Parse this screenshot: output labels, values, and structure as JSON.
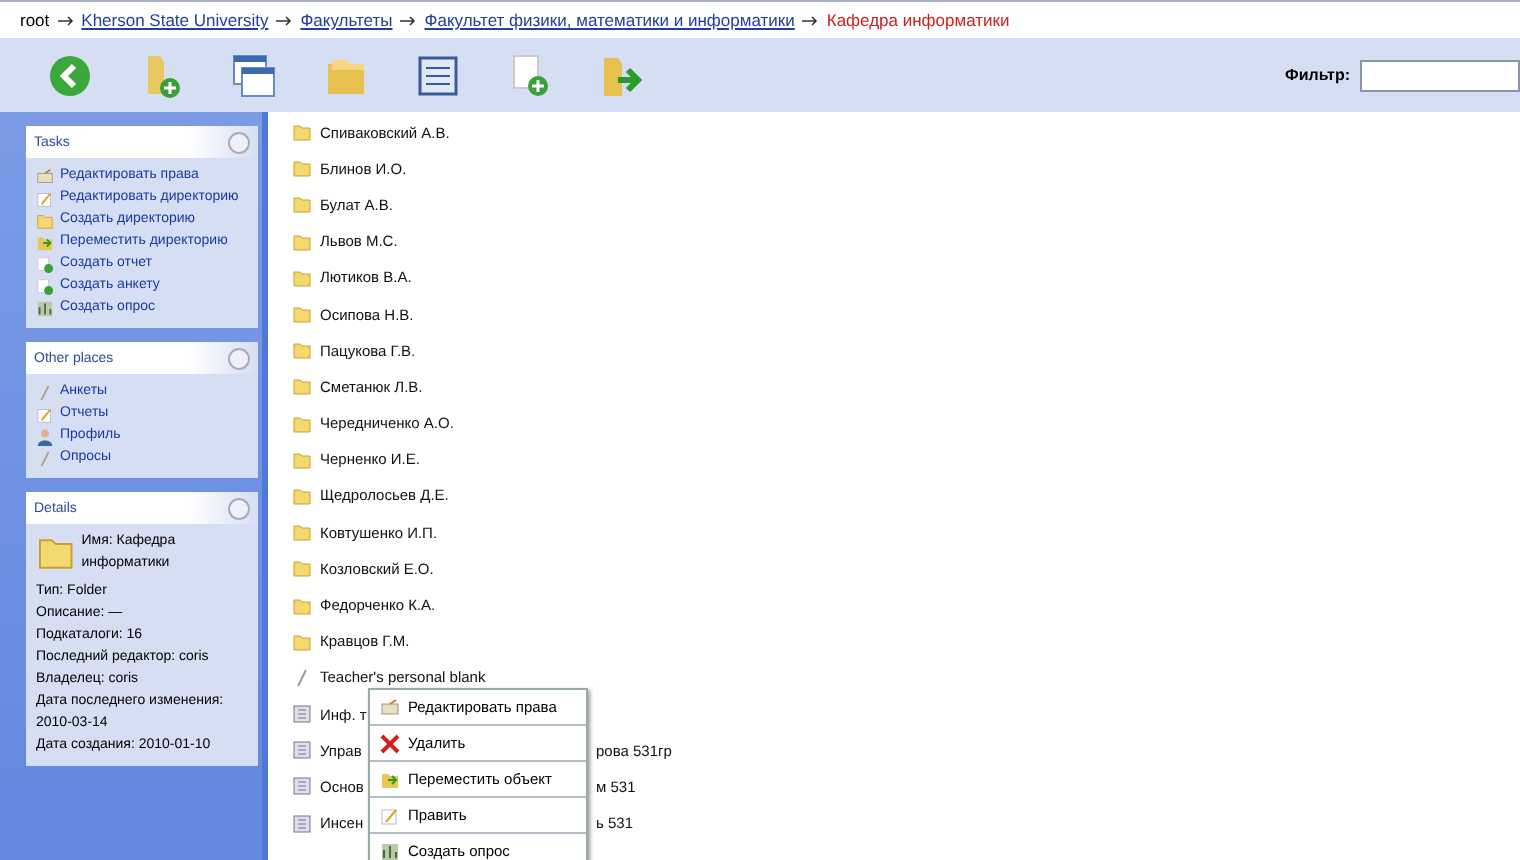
{
  "breadcrumb": [
    {
      "label": "root",
      "kind": "plain"
    },
    {
      "label": "Kherson State University",
      "kind": "link"
    },
    {
      "label": "Факультеты",
      "kind": "link"
    },
    {
      "label": "Факультет физики, математики и информатики",
      "kind": "link"
    },
    {
      "label": "Кафедра информатики",
      "kind": "current"
    }
  ],
  "filter": {
    "label": "Фильтр:"
  },
  "sidebar": {
    "panels": [
      {
        "title": "Tasks",
        "items": [
          {
            "label": "Редактировать права",
            "kind": "rights"
          },
          {
            "label": "Редактировать директорию",
            "kind": "edit"
          },
          {
            "label": "Создать директорию",
            "kind": "folder"
          },
          {
            "label": "Переместить директорию",
            "kind": "move"
          },
          {
            "label": "Создать отчет",
            "kind": "add"
          },
          {
            "label": "Создать анкету",
            "kind": "add"
          },
          {
            "label": "Создать опрос",
            "kind": "poll"
          }
        ]
      },
      {
        "title": "Other places",
        "items": [
          {
            "label": "Анкеты",
            "kind": "pen"
          },
          {
            "label": "Отчеты",
            "kind": "edit"
          },
          {
            "label": "Профиль",
            "kind": "user"
          },
          {
            "label": "Опросы",
            "kind": "pen"
          }
        ]
      }
    ],
    "details": {
      "title": "Details",
      "name": "Имя: Кафедра информатики",
      "lines": [
        "Тип: Folder",
        "Описание: —",
        "Подкаталоги: 16",
        "Последний редактор: coris",
        "Владелец: coris",
        "Дата последнего изменения: 2010-03-14",
        "Дата создания: 2010-01-10"
      ]
    }
  },
  "rows": [
    {
      "kind": "folder",
      "label": "Спиваковский А.В."
    },
    {
      "kind": "folder",
      "label": "Блинов И.О."
    },
    {
      "kind": "folder",
      "label": "Булат А.В."
    },
    {
      "kind": "folder",
      "label": "Львов М.С."
    },
    {
      "kind": "folder",
      "label": "Лютиков В.А."
    },
    {
      "kind": "folder",
      "label": "Осипова Н.В."
    },
    {
      "kind": "folder",
      "label": "Пацукова Г.В."
    },
    {
      "kind": "folder",
      "label": "Сметанюк Л.В."
    },
    {
      "kind": "folder",
      "label": "Чередниченко А.О."
    },
    {
      "kind": "folder",
      "label": "Черненко И.Е."
    },
    {
      "kind": "folder",
      "label": "Щедролосьев Д.Е."
    },
    {
      "kind": "folder",
      "label": "Ковтушенко И.П."
    },
    {
      "kind": "folder",
      "label": "Козловский Е.О."
    },
    {
      "kind": "folder",
      "label": "Федорченко К.А."
    },
    {
      "kind": "folder",
      "label": "Кравцов Г.М."
    },
    {
      "kind": "blank",
      "label": "Teacher's personal blank"
    },
    {
      "kind": "report",
      "label": "Инф. т"
    },
    {
      "kind": "report",
      "label": "Управ",
      "suffix": "рова 531гр"
    },
    {
      "kind": "report",
      "label": "Основ",
      "suffix": "м 531"
    },
    {
      "kind": "report",
      "label": "Инсен",
      "suffix": "ь 531"
    }
  ],
  "context_menu": [
    {
      "label": "Редактировать права",
      "kind": "rights"
    },
    {
      "label": "Удалить",
      "kind": "delete"
    },
    {
      "label": "Переместить объект",
      "kind": "move"
    },
    {
      "label": "Править",
      "kind": "edit"
    },
    {
      "label": "Создать опрос",
      "kind": "poll"
    }
  ]
}
